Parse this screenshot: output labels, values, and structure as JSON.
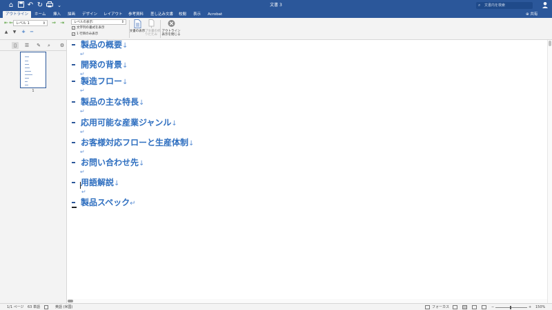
{
  "window": {
    "title": "文書 3",
    "search_placeholder": "文書内を検索"
  },
  "titlebar_icons": [
    "home-icon",
    "save-icon",
    "undo-icon",
    "redo-icon",
    "print-icon",
    "more-icon"
  ],
  "ribbon": {
    "tabs": [
      "アウトライン",
      "ホーム",
      "挿入",
      "描画",
      "デザイン",
      "レイアウト",
      "参考資料",
      "差し込み文書",
      "校閲",
      "表示",
      "Acrobat"
    ],
    "active_tab": "アウトライン",
    "share_label": "共有",
    "outline_level": "レベル 1",
    "show_level_label": "レベルの表示:",
    "show_text_formatting": "文字列の書式を表示",
    "show_first_line_only": "1 行目のみ表示",
    "show_document_label": "文書の表示",
    "collapse_subdocuments_label": "サブ文書の折りたたみ",
    "close_outline_label": "アウトライン表示を閉じる"
  },
  "outline": {
    "headings": [
      "製品の概要",
      "開発の背景",
      "製造フロー",
      "製品の主な特長",
      "応用可能な産業ジャンル",
      "お客様対応フローと生産体制",
      "お問い合わせ先",
      "用語解説",
      "製品スペック"
    ],
    "line_break_mark": "↓",
    "paragraph_mark": "↵"
  },
  "navigation": {
    "thumbnail_page_number": "1"
  },
  "statusbar": {
    "page_info": "1/1 ページ",
    "word_count": "63 単語",
    "language": "英語 (米国)",
    "focus_label": "フォーカス",
    "zoom": "150%"
  },
  "colors": {
    "brand": "#2b579a",
    "heading_text": "#2f6fc0",
    "marks": "#6b98d8"
  }
}
